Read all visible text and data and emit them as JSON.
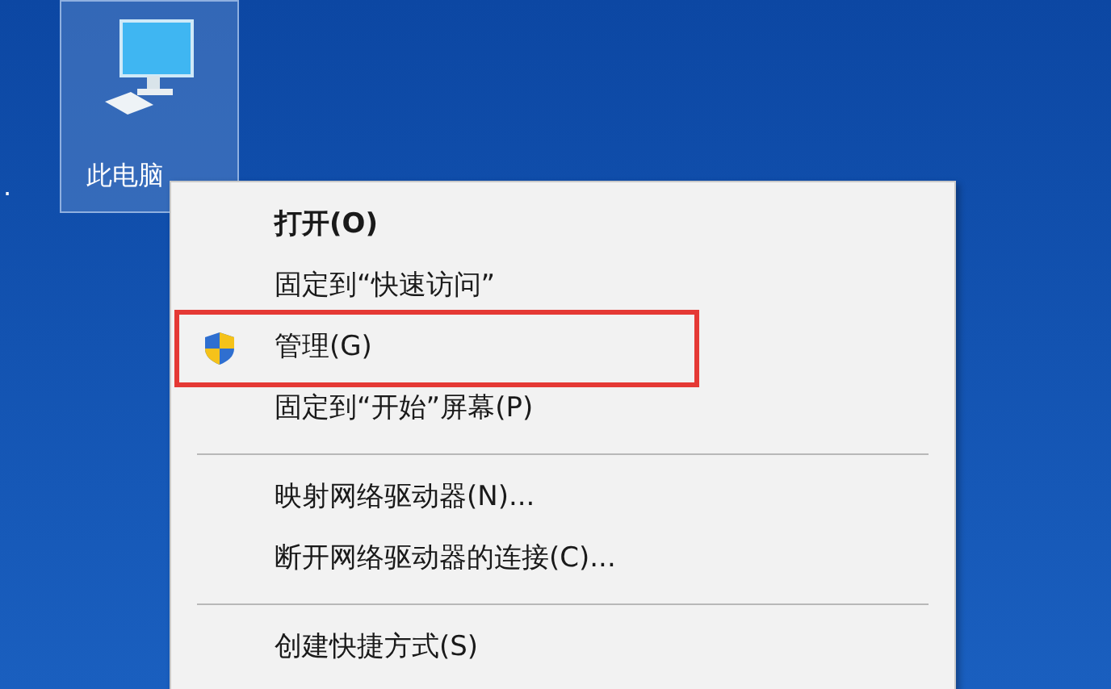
{
  "desktop": {
    "icons": [
      {
        "label": ".",
        "selected": false
      },
      {
        "label": "此电脑",
        "selected": true
      }
    ]
  },
  "context_menu": {
    "items": [
      {
        "kind": "item",
        "label": "打开(O)",
        "default": true,
        "shield": false,
        "highlighted": false
      },
      {
        "kind": "item",
        "label": "固定到“快速访问”",
        "default": false,
        "shield": false,
        "highlighted": false
      },
      {
        "kind": "item",
        "label": "管理(G)",
        "default": false,
        "shield": true,
        "highlighted": true
      },
      {
        "kind": "item",
        "label": "固定到“开始”屏幕(P)",
        "default": false,
        "shield": false,
        "highlighted": false
      },
      {
        "kind": "separator"
      },
      {
        "kind": "item",
        "label": "映射网络驱动器(N)...",
        "default": false,
        "shield": false,
        "highlighted": false
      },
      {
        "kind": "item",
        "label": "断开网络驱动器的连接(C)...",
        "default": false,
        "shield": false,
        "highlighted": false
      },
      {
        "kind": "separator"
      },
      {
        "kind": "item",
        "label": "创建快捷方式(S)",
        "default": false,
        "shield": false,
        "highlighted": false
      }
    ]
  }
}
